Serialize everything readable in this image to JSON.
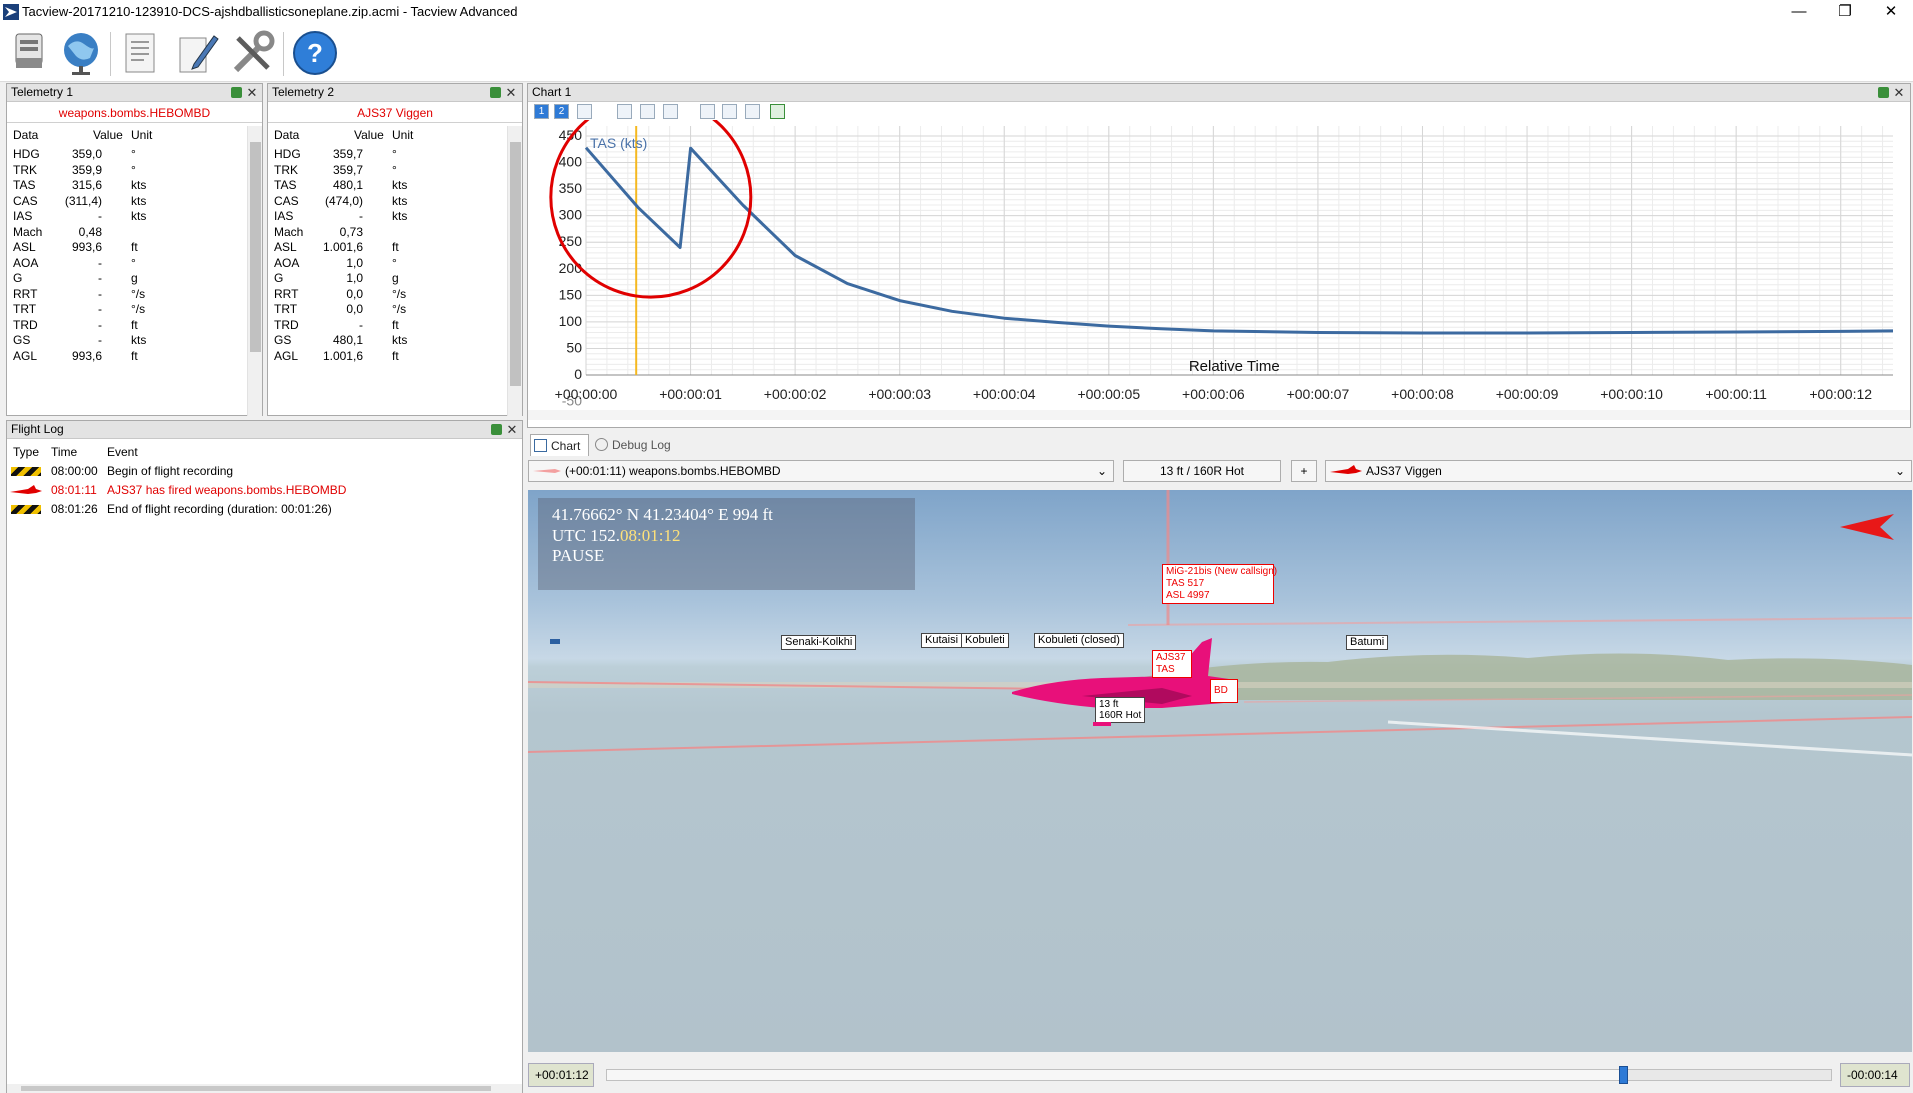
{
  "window": {
    "title": "Tacview-20171210-123910-DCS-ajshdballisticsoneplane.zip.acmi - Tacview Advanced",
    "minimize": "—",
    "restore": "❐",
    "close": "✕"
  },
  "toolbar": {
    "items": [
      "open-recording-icon",
      "globe-icon",
      "document-icon",
      "pen-icon",
      "tools-icon",
      "help-icon"
    ],
    "help_glyph": "?"
  },
  "telemetry1": {
    "title": "Telemetry 1",
    "object": "weapons.bombs.HEBOMBD",
    "headers": {
      "data": "Data",
      "value": "Value",
      "unit": "Unit"
    },
    "rows": [
      {
        "data": "HDG",
        "value": "359,0",
        "unit": "°"
      },
      {
        "data": "TRK",
        "value": "359,9",
        "unit": "°"
      },
      {
        "data": "TAS",
        "value": "315,6",
        "unit": "kts"
      },
      {
        "data": "CAS",
        "value": "(311,4)",
        "unit": "kts"
      },
      {
        "data": "IAS",
        "value": "-",
        "unit": "kts"
      },
      {
        "data": "Mach",
        "value": "0,48",
        "unit": ""
      },
      {
        "data": "ASL",
        "value": "993,6",
        "unit": "ft"
      },
      {
        "data": "AOA",
        "value": "-",
        "unit": "°"
      },
      {
        "data": "G",
        "value": "-",
        "unit": "g"
      },
      {
        "data": "RRT",
        "value": "-",
        "unit": "°/s"
      },
      {
        "data": "TRT",
        "value": "-",
        "unit": "°/s"
      },
      {
        "data": "TRD",
        "value": "-",
        "unit": "ft"
      },
      {
        "data": "GS",
        "value": "-",
        "unit": "kts"
      },
      {
        "data": "AGL",
        "value": "993,6",
        "unit": "ft"
      }
    ]
  },
  "telemetry2": {
    "title": "Telemetry 2",
    "object": "AJS37 Viggen",
    "headers": {
      "data": "Data",
      "value": "Value",
      "unit": "Unit"
    },
    "rows": [
      {
        "data": "HDG",
        "value": "359,7",
        "unit": "°"
      },
      {
        "data": "TRK",
        "value": "359,7",
        "unit": "°"
      },
      {
        "data": "TAS",
        "value": "480,1",
        "unit": "kts"
      },
      {
        "data": "CAS",
        "value": "(474,0)",
        "unit": "kts"
      },
      {
        "data": "IAS",
        "value": "-",
        "unit": "kts"
      },
      {
        "data": "Mach",
        "value": "0,73",
        "unit": ""
      },
      {
        "data": "ASL",
        "value": "1.001,6",
        "unit": "ft"
      },
      {
        "data": "AOA",
        "value": "1,0",
        "unit": "°"
      },
      {
        "data": "G",
        "value": "1,0",
        "unit": "g"
      },
      {
        "data": "RRT",
        "value": "0,0",
        "unit": "°/s"
      },
      {
        "data": "TRT",
        "value": "0,0",
        "unit": "°/s"
      },
      {
        "data": "TRD",
        "value": "-",
        "unit": "ft"
      },
      {
        "data": "GS",
        "value": "480,1",
        "unit": "kts"
      },
      {
        "data": "AGL",
        "value": "1.001,6",
        "unit": "ft"
      }
    ]
  },
  "flight_log": {
    "title": "Flight Log",
    "headers": {
      "type": "Type",
      "time": "Time",
      "event": "Event"
    },
    "rows": [
      {
        "type": "hazard-icon",
        "time": "08:00:00",
        "event": "Begin of flight recording",
        "color": "#000000"
      },
      {
        "type": "aircraft-icon",
        "time": "08:01:11",
        "event": "AJS37 has fired weapons.bombs.HEBOMBD",
        "color": "#e00000"
      },
      {
        "type": "hazard-icon",
        "time": "08:01:26",
        "event": "End of flight recording (duration: 00:01:26)",
        "color": "#000000"
      }
    ]
  },
  "chart_panel": {
    "title": "Chart 1",
    "tool_one": "1",
    "tool_two": "2"
  },
  "chart_data": {
    "type": "line",
    "ylabel": "TAS (kts)",
    "xlabel": "Relative Time",
    "ylim": [
      -50,
      450
    ],
    "xlim": [
      0,
      12.5
    ],
    "grid": true,
    "y_ticks": [
      {
        "v": 450,
        "label": "450"
      },
      {
        "v": 400,
        "label": "400"
      },
      {
        "v": 350,
        "label": "350"
      },
      {
        "v": 300,
        "label": "300"
      },
      {
        "v": 250,
        "label": "250"
      },
      {
        "v": 200,
        "label": "200"
      },
      {
        "v": 150,
        "label": "150"
      },
      {
        "v": 100,
        "label": "100"
      },
      {
        "v": 50,
        "label": "50"
      },
      {
        "v": 0,
        "label": "0"
      },
      {
        "v": -50,
        "label": "-50"
      }
    ],
    "x_ticks": [
      {
        "v": 0,
        "label": "+00:00:00"
      },
      {
        "v": 1,
        "label": "+00:00:01"
      },
      {
        "v": 2,
        "label": "+00:00:02"
      },
      {
        "v": 3,
        "label": "+00:00:03"
      },
      {
        "v": 4,
        "label": "+00:00:04"
      },
      {
        "v": 5,
        "label": "+00:00:05"
      },
      {
        "v": 6,
        "label": "+00:00:06"
      },
      {
        "v": 7,
        "label": "+00:00:07"
      },
      {
        "v": 8,
        "label": "+00:00:08"
      },
      {
        "v": 9,
        "label": "+00:00:09"
      },
      {
        "v": 10,
        "label": "+00:00:10"
      },
      {
        "v": 11,
        "label": "+00:00:11"
      },
      {
        "v": 12,
        "label": "+00:00:12"
      }
    ],
    "cursor_x": 0.48,
    "series": [
      {
        "name": "weapons.bombs.HEBOMBD",
        "color": "#3c6aa0",
        "points": [
          [
            0,
            428
          ],
          [
            0.5,
            315
          ],
          [
            0.9,
            240
          ],
          [
            1.0,
            427
          ],
          [
            1.5,
            320
          ],
          [
            2.0,
            225
          ],
          [
            2.5,
            172
          ],
          [
            3.0,
            140
          ],
          [
            3.5,
            120
          ],
          [
            4.0,
            107
          ],
          [
            4.5,
            99
          ],
          [
            5.0,
            92
          ],
          [
            5.5,
            87
          ],
          [
            6.0,
            83
          ],
          [
            7.0,
            80
          ],
          [
            8.0,
            79
          ],
          [
            9.0,
            79
          ],
          [
            10.0,
            80
          ],
          [
            11.0,
            81
          ],
          [
            12.0,
            82
          ],
          [
            12.5,
            83
          ]
        ]
      }
    ],
    "highlight_circle_color": "#e00000"
  },
  "tabs": {
    "chart": "Chart 1",
    "debug": "Debug Log"
  },
  "view_bar": {
    "object_select": "(+00:01:11) weapons.bombs.HEBOMBD",
    "info": "13 ft / 160R Hot",
    "plus": "+",
    "target_select": "AJS37 Viggen"
  },
  "hud": {
    "coords": "41.76662° N  41.23404° E  994 ft",
    "utc_prefix": "UTC 152.",
    "utc_time": "08:01:12",
    "state": "PAUSE"
  },
  "scene": {
    "airports": [
      "Senaki-Kolkhi",
      "Kutaisi",
      "Kobuleti",
      "Kobuleti (closed)",
      "Batumi"
    ],
    "mig_label": [
      "MiG-21bis (New callsign)",
      "TAS 517",
      "ASL 4997"
    ],
    "ajs_label": [
      "AJS37",
      "TAS"
    ],
    "bomb_label_1": "13 ft",
    "bomb_label_2": "160R Hot",
    "partial_label": "BD"
  },
  "timeline": {
    "current": "+00:01:12",
    "remaining": "-00:00:14",
    "position": 0.83
  }
}
